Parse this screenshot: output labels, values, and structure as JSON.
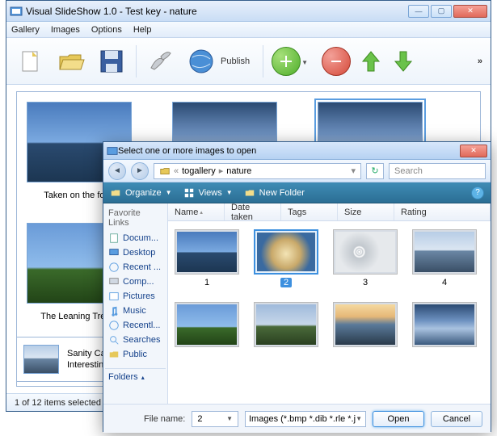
{
  "main": {
    "title": "Visual SlideShow 1.0 - Test key - nature",
    "menu": {
      "gallery": "Gallery",
      "images": "Images",
      "options": "Options",
      "help": "Help"
    },
    "toolbar": {
      "publish": "Publish"
    },
    "thumbs": [
      {
        "caption": "Taken on the for..."
      },
      {
        "caption": ""
      },
      {
        "caption": ""
      },
      {
        "caption": "The Leaning Tree..."
      }
    ],
    "detail": {
      "line1": "Sanity Ca",
      "line2": "Interestin"
    },
    "status": "1 of 12 items selected"
  },
  "dialog": {
    "title": "Select one or more images to open",
    "breadcrumb": {
      "seg1": "togallery",
      "seg2": "nature"
    },
    "search_placeholder": "Search",
    "tools": {
      "organize": "Organize",
      "views": "Views",
      "newfolder": "New Folder"
    },
    "sidebar": {
      "header": "Favorite Links",
      "items": [
        "Docum...",
        "Desktop",
        "Recent ...",
        "Comp...",
        "Pictures",
        "Music",
        "Recentl...",
        "Searches",
        "Public"
      ],
      "folders": "Folders"
    },
    "columns": {
      "name": "Name",
      "date": "Date taken",
      "tags": "Tags",
      "size": "Size",
      "rating": "Rating"
    },
    "files": [
      {
        "label": "1"
      },
      {
        "label": "2"
      },
      {
        "label": "3"
      },
      {
        "label": "4"
      },
      {
        "label": ""
      },
      {
        "label": ""
      },
      {
        "label": ""
      },
      {
        "label": ""
      }
    ],
    "footer": {
      "filename_label": "File name:",
      "filename_value": "2",
      "filter": "Images (*.bmp *.dib *.rle *.jpg *",
      "open": "Open",
      "cancel": "Cancel"
    }
  }
}
